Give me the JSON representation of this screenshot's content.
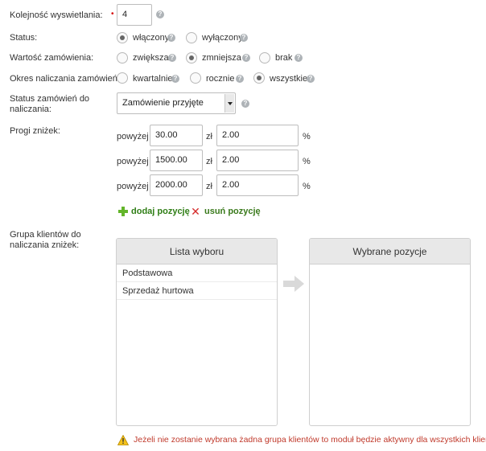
{
  "fields": {
    "display_order": {
      "label": "Kolejność wyswietlania:",
      "value": "4"
    },
    "status": {
      "label": "Status:",
      "options": [
        "włączony",
        "wyłączony"
      ],
      "selected": "włączony"
    },
    "order_value": {
      "label": "Wartość zamówienia:",
      "options": [
        "zwiększa",
        "zmniejsza",
        "brak"
      ],
      "selected": "zmniejsza"
    },
    "billing_period": {
      "label": "Okres naliczania zamówień:",
      "options": [
        "kwartalnie",
        "rocznie",
        "wszystkie"
      ],
      "selected": "wszystkie"
    },
    "order_status": {
      "label_line1": "Status zamówień do",
      "label_line2": "naliczania:",
      "value": "Zamówienie przyjęte"
    }
  },
  "thresholds": {
    "label": "Progi zniżek:",
    "above_label": "powyżej",
    "currency": "zł",
    "percent": "%",
    "rows": [
      {
        "amount": "30.00",
        "discount": "2.00"
      },
      {
        "amount": "1500.00",
        "discount": "2.00"
      },
      {
        "amount": "2000.00",
        "discount": "2.00"
      }
    ],
    "add_label": "dodaj pozycję",
    "remove_label": "usuń pozycję"
  },
  "client_groups": {
    "label_line1": "Grupa klientów do",
    "label_line2": "naliczania zniżek:",
    "available_title": "Lista wyboru",
    "available_items": [
      "Podstawowa",
      "Sprzedaż hurtowa"
    ],
    "selected_title": "Wybrane pozycje",
    "selected_items": []
  },
  "warning": "Jeżeli nie zostanie wybrana żadna grupa klientów to moduł będzie aktywny dla wszystkich klientów.",
  "help_glyph": "?",
  "icons": [
    "help-icon",
    "plus-icon",
    "close-icon",
    "arrow-right-icon",
    "warning-icon"
  ],
  "colors": {
    "warning_text": "#c0392b",
    "action_text": "#2e7d14",
    "panel_header": "#e8e8e8"
  }
}
